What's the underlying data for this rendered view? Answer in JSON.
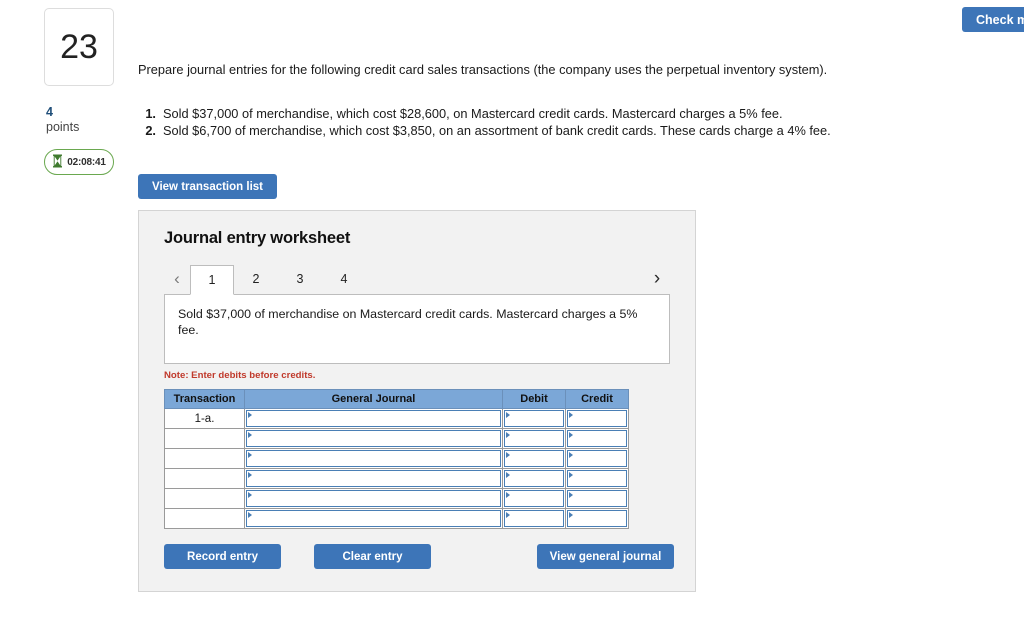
{
  "header": {
    "check_work_label": "Check my work"
  },
  "gutter": {
    "question_number": "23",
    "points_value": "4",
    "points_label": "points",
    "timer_value": "02:08:41",
    "hourglass_icon": "hourglass-icon"
  },
  "question": {
    "prompt": "Prepare journal entries for the following credit card sales transactions (the company uses the perpetual inventory system).",
    "requirements": [
      {
        "num": "1.",
        "text": "Sold $37,000 of merchandise, which cost $28,600, on Mastercard credit cards. Mastercard charges a 5% fee."
      },
      {
        "num": "2.",
        "text": "Sold $6,700 of merchandise, which cost $3,850, on an assortment of bank credit cards. These cards charge a 4% fee."
      }
    ],
    "view_transaction_label": "View transaction list"
  },
  "worksheet": {
    "title": "Journal entry worksheet",
    "prev_arrow": "chevron-left-icon",
    "next_arrow": "chevron-right-icon",
    "tabs": [
      {
        "label": "1",
        "active": true
      },
      {
        "label": "2",
        "active": false
      },
      {
        "label": "3",
        "active": false
      },
      {
        "label": "4",
        "active": false
      }
    ],
    "transaction_description": "Sold $37,000 of merchandise on Mastercard credit cards. Mastercard charges a 5% fee.",
    "note": "Note: Enter debits before credits.",
    "table": {
      "columns": [
        "Transaction",
        "General Journal",
        "Debit",
        "Credit"
      ],
      "rows": [
        {
          "transaction": "1-a.",
          "general_journal": "",
          "debit": "",
          "credit": ""
        },
        {
          "transaction": "",
          "general_journal": "",
          "debit": "",
          "credit": ""
        },
        {
          "transaction": "",
          "general_journal": "",
          "debit": "",
          "credit": ""
        },
        {
          "transaction": "",
          "general_journal": "",
          "debit": "",
          "credit": ""
        },
        {
          "transaction": "",
          "general_journal": "",
          "debit": "",
          "credit": ""
        },
        {
          "transaction": "",
          "general_journal": "",
          "debit": "",
          "credit": ""
        }
      ]
    },
    "actions": {
      "record_entry": "Record entry",
      "clear_entry": "Clear entry",
      "view_general_journal": "View general journal"
    }
  },
  "colors": {
    "button_blue": "#3d75b8",
    "table_header_blue": "#7ba7d7",
    "input_border_blue": "#4a7fb5",
    "note_red": "#c0392b",
    "timer_green": "#6aa84f",
    "points_blue": "#1f4e79",
    "panel_gray": "#f2f2f2"
  }
}
